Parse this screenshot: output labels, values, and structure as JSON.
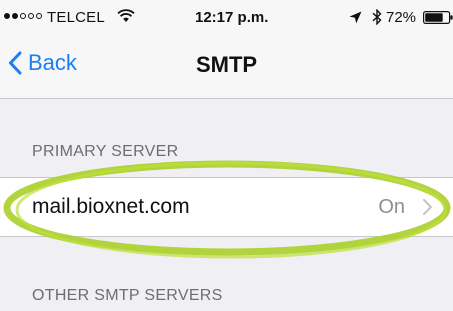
{
  "status_bar": {
    "carrier": "TELCEL",
    "time": "12:17 p.m.",
    "battery": "72%",
    "signal_filled": 2,
    "signal_total": 5,
    "icons": [
      "wifi-icon",
      "location-arrow-icon",
      "bluetooth-icon",
      "battery-icon"
    ]
  },
  "nav": {
    "back_label": "Back",
    "title": "SMTP",
    "back_icon": "chevron-left-icon"
  },
  "primary_section": {
    "header": "PRIMARY SERVER",
    "server": {
      "name": "mail.bioxnet.com",
      "status": "On",
      "icon": "chevron-right-icon"
    }
  },
  "other_section": {
    "header": "OTHER SMTP SERVERS"
  },
  "colors": {
    "ios_blue": "#1a7ff5",
    "background": "#efeff4",
    "highlight_green": "#a8cf2a",
    "secondary_text": "#8e8e93"
  }
}
